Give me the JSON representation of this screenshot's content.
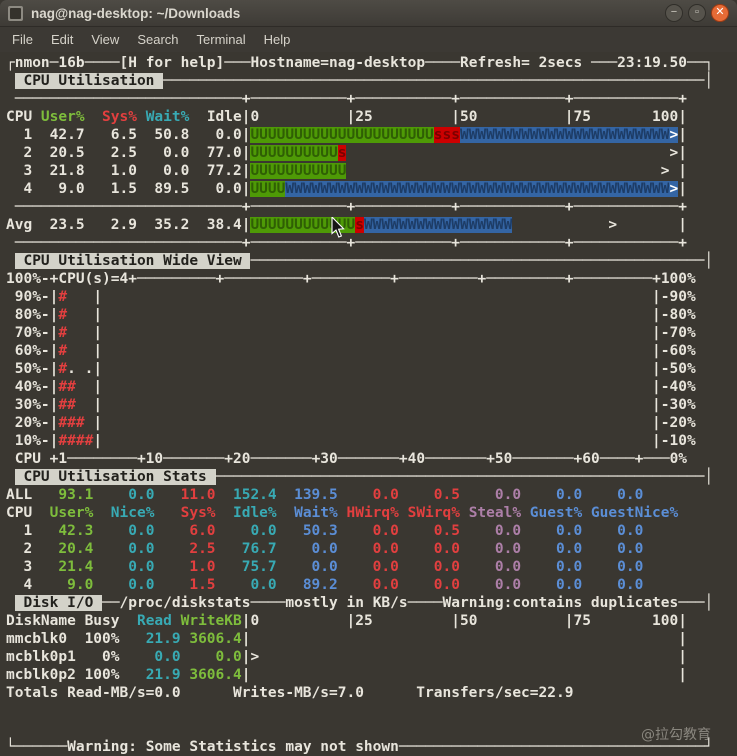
{
  "window": {
    "title": "nag@nag-desktop: ~/Downloads",
    "controls": [
      {
        "id": "minimize",
        "glyph": "−"
      },
      {
        "id": "maximize",
        "glyph": "▫"
      },
      {
        "id": "close",
        "glyph": "✕"
      }
    ]
  },
  "menu": {
    "items": [
      "File",
      "Edit",
      "View",
      "Search",
      "Terminal",
      "Help"
    ]
  },
  "watermark": "@拉勾教育",
  "colors": {
    "fg": "#e8e5dc",
    "bg": "#3a3731",
    "menubar": "#3c3934",
    "close": "#e66b36",
    "green": "#7ebd3c",
    "red": "#e23f3f",
    "cyan": "#38aab4",
    "blue": "#5b8ed6",
    "magenta": "#ad7fa8",
    "inverse_bg": "#d3d2c9",
    "inverse_fg": "#22211d",
    "bar_green": "#4e9a06",
    "bar_green_char": "#2f5f04",
    "bar_red": "#cc0000",
    "bar_red_char": "#7d0000",
    "bar_blue": "#3465a4",
    "bar_blue_char": "#1d3c66"
  },
  "terminal": {
    "lines": [
      [
        {
          "t": "┌nmon─16b"
        },
        {
          "ch": "─",
          "n": 4
        },
        {
          "t": "[H for help]"
        },
        {
          "ch": "─",
          "n": 3
        },
        {
          "t": "Hostname=nag-desktop"
        },
        {
          "ch": "─",
          "n": 4
        },
        {
          "t": "Refresh= 2secs "
        },
        {
          "ch": "─",
          "n": 3
        },
        {
          "t": "23:19.50"
        },
        {
          "ch": "─",
          "n": 2
        },
        {
          "t": "┐"
        }
      ],
      [
        {
          "t": " "
        },
        {
          "t": " CPU Utilisation ",
          "c": "i"
        },
        {
          "ch": "─",
          "n": 62
        },
        {
          "t": "│"
        }
      ],
      [
        {
          "t": " "
        },
        {
          "ch": "─",
          "n": 26
        },
        {
          "t": "+"
        },
        {
          "ch": "─",
          "n": 11
        },
        {
          "t": "+"
        },
        {
          "ch": "─",
          "n": 11
        },
        {
          "t": "+"
        },
        {
          "ch": "─",
          "n": 12
        },
        {
          "t": "+"
        },
        {
          "ch": "─",
          "n": 12
        },
        {
          "t": "+"
        }
      ],
      [
        {
          "t": "CPU "
        },
        {
          "t": "User%",
          "c": "g"
        },
        {
          "t": "  "
        },
        {
          "t": "Sys%",
          "c": "r"
        },
        {
          "t": " "
        },
        {
          "t": "Wait%",
          "c": "c"
        },
        {
          "t": "  "
        },
        {
          "t": "Idle"
        },
        {
          "t": "|0          |25         |50          |75       100|"
        }
      ],
      [
        {
          "t": "  1  42.7   6.5  50.8   0.0"
        },
        {
          "t": "|"
        },
        {
          "ch": "U",
          "n": 21,
          "c": "bu"
        },
        {
          "ch": "s",
          "n": 3,
          "c": "bs"
        },
        {
          "ch": "W",
          "n": 24,
          "c": "bw"
        },
        {
          "t": ">",
          "c": "bp"
        },
        {
          "t": "|"
        }
      ],
      [
        {
          "t": "  2  20.5   2.5   0.0  77.0"
        },
        {
          "t": "|"
        },
        {
          "ch": "U",
          "n": 10,
          "c": "bu"
        },
        {
          "ch": "s",
          "n": 1,
          "c": "bs"
        },
        {
          "ch": " ",
          "n": 37
        },
        {
          "t": ">"
        },
        {
          "t": "|"
        }
      ],
      [
        {
          "t": "  3  21.8   1.0   0.0  77.2"
        },
        {
          "t": "|"
        },
        {
          "ch": "U",
          "n": 11,
          "c": "bu"
        },
        {
          "ch": " ",
          "n": 36
        },
        {
          "t": ">"
        },
        {
          "t": " "
        },
        {
          "t": "|"
        }
      ],
      [
        {
          "t": "  4   9.0   1.5  89.5   0.0"
        },
        {
          "t": "|"
        },
        {
          "ch": "U",
          "n": 4,
          "c": "bu"
        },
        {
          "ch": "W",
          "n": 44,
          "c": "bw"
        },
        {
          "t": ">",
          "c": "bp"
        },
        {
          "t": "|"
        }
      ],
      [
        {
          "t": " "
        },
        {
          "ch": "─",
          "n": 26
        },
        {
          "t": "+"
        },
        {
          "ch": "─",
          "n": 11
        },
        {
          "t": "+"
        },
        {
          "ch": "─",
          "n": 11
        },
        {
          "t": "+"
        },
        {
          "ch": "─",
          "n": 12
        },
        {
          "t": "+"
        },
        {
          "ch": "─",
          "n": 12
        },
        {
          "t": "+"
        }
      ],
      [
        {
          "t": "Avg  23.5   2.9  35.2  38.4"
        },
        {
          "t": "|"
        },
        {
          "ch": "U",
          "n": 12,
          "c": "bu"
        },
        {
          "ch": "s",
          "n": 1,
          "c": "bs"
        },
        {
          "ch": "W",
          "n": 17,
          "c": "bw"
        },
        {
          "ch": " ",
          "n": 11
        },
        {
          "t": ">"
        },
        {
          "ch": " ",
          "n": 7
        },
        {
          "t": "|"
        }
      ],
      [
        {
          "t": " "
        },
        {
          "ch": "─",
          "n": 26
        },
        {
          "t": "+"
        },
        {
          "ch": "─",
          "n": 11
        },
        {
          "t": "+"
        },
        {
          "ch": "─",
          "n": 11
        },
        {
          "t": "+"
        },
        {
          "ch": "─",
          "n": 12
        },
        {
          "t": "+"
        },
        {
          "ch": "─",
          "n": 12
        },
        {
          "t": "+"
        }
      ],
      [
        {
          "t": " "
        },
        {
          "t": " CPU Utilisation Wide View ",
          "c": "i"
        },
        {
          "ch": "─",
          "n": 52
        },
        {
          "t": "│"
        }
      ],
      [
        {
          "t": "100%-+CPU(s)=4+"
        },
        {
          "ch": "─",
          "n": 9
        },
        {
          "t": "+"
        },
        {
          "ch": "─",
          "n": 9
        },
        {
          "t": "+"
        },
        {
          "ch": "─",
          "n": 9
        },
        {
          "t": "+"
        },
        {
          "ch": "─",
          "n": 9
        },
        {
          "t": "+"
        },
        {
          "ch": "─",
          "n": 9
        },
        {
          "t": "+"
        },
        {
          "ch": "─",
          "n": 9
        },
        {
          "t": "+"
        },
        {
          "t": "100%"
        }
      ],
      [
        {
          "t": " 90%-|"
        },
        {
          "t": "#",
          "c": "r"
        },
        {
          "t": "   "
        },
        {
          "t": "|"
        },
        {
          "ch": " ",
          "n": 63
        },
        {
          "t": "|-90%"
        }
      ],
      [
        {
          "t": " 80%-|"
        },
        {
          "t": "#",
          "c": "r"
        },
        {
          "t": "   "
        },
        {
          "t": "|"
        },
        {
          "ch": " ",
          "n": 63
        },
        {
          "t": "|-80%"
        }
      ],
      [
        {
          "t": " 70%-|"
        },
        {
          "t": "#",
          "c": "r"
        },
        {
          "t": "   "
        },
        {
          "t": "|"
        },
        {
          "ch": " ",
          "n": 63
        },
        {
          "t": "|-70%"
        }
      ],
      [
        {
          "t": " 60%-|"
        },
        {
          "t": "#",
          "c": "r"
        },
        {
          "t": "   "
        },
        {
          "t": "|"
        },
        {
          "ch": " ",
          "n": 63
        },
        {
          "t": "|-60%"
        }
      ],
      [
        {
          "t": " 50%-|"
        },
        {
          "t": "#",
          "c": "r"
        },
        {
          "t": ". ."
        },
        {
          "t": "|"
        },
        {
          "ch": " ",
          "n": 63
        },
        {
          "t": "|-50%"
        }
      ],
      [
        {
          "t": " 40%-|"
        },
        {
          "t": "##",
          "c": "r"
        },
        {
          "t": "  "
        },
        {
          "t": "|"
        },
        {
          "ch": " ",
          "n": 63
        },
        {
          "t": "|-40%"
        }
      ],
      [
        {
          "t": " 30%-|"
        },
        {
          "t": "##",
          "c": "r"
        },
        {
          "t": "  "
        },
        {
          "t": "|"
        },
        {
          "ch": " ",
          "n": 63
        },
        {
          "t": "|-30%"
        }
      ],
      [
        {
          "t": " 20%-|"
        },
        {
          "t": "###",
          "c": "r"
        },
        {
          "t": " "
        },
        {
          "t": "|"
        },
        {
          "ch": " ",
          "n": 63
        },
        {
          "t": "|-20%"
        }
      ],
      [
        {
          "t": " 10%-|"
        },
        {
          "t": "####",
          "c": "r"
        },
        {
          "t": "|"
        },
        {
          "ch": " ",
          "n": 63
        },
        {
          "t": "|-10%"
        }
      ],
      [
        {
          "t": " CPU +1"
        },
        {
          "ch": "─",
          "n": 8
        },
        {
          "t": "+10"
        },
        {
          "ch": "─",
          "n": 7
        },
        {
          "t": "+20"
        },
        {
          "ch": "─",
          "n": 7
        },
        {
          "t": "+30"
        },
        {
          "ch": "─",
          "n": 7
        },
        {
          "t": "+40"
        },
        {
          "ch": "─",
          "n": 7
        },
        {
          "t": "+50"
        },
        {
          "ch": "─",
          "n": 7
        },
        {
          "t": "+60"
        },
        {
          "ch": "─",
          "n": 4
        },
        {
          "t": "+"
        },
        {
          "ch": "─",
          "n": 3
        },
        {
          "t": "0%"
        }
      ],
      [
        {
          "t": " "
        },
        {
          "t": " CPU Utilisation Stats ",
          "c": "i"
        },
        {
          "ch": "─",
          "n": 56
        },
        {
          "t": "│"
        }
      ],
      [
        {
          "t": "ALL"
        },
        {
          "t": "   93.1",
          "c": "g"
        },
        {
          "t": "    0.0",
          "c": "c"
        },
        {
          "t": "   11.0",
          "c": "r"
        },
        {
          "t": "  152.4",
          "c": "c"
        },
        {
          "t": "  139.5",
          "c": "b"
        },
        {
          "t": "    0.0",
          "c": "r"
        },
        {
          "t": "    0.5",
          "c": "r"
        },
        {
          "t": "    0.0",
          "c": "m"
        },
        {
          "t": "    0.0",
          "c": "b"
        },
        {
          "t": "    0.0",
          "c": "b"
        }
      ],
      [
        {
          "t": "CPU"
        },
        {
          "t": "  User%",
          "c": "g"
        },
        {
          "t": "  Nice%",
          "c": "c"
        },
        {
          "t": "   Sys%",
          "c": "r"
        },
        {
          "t": "  Idle%",
          "c": "c"
        },
        {
          "t": "  Wait%",
          "c": "b"
        },
        {
          "t": " HWirq%",
          "c": "r"
        },
        {
          "t": " SWirq%",
          "c": "r"
        },
        {
          "t": " Steal%",
          "c": "m"
        },
        {
          "t": " Guest%",
          "c": "b"
        },
        {
          "t": " GuestNice%",
          "c": "b"
        }
      ],
      [
        {
          "t": "  1"
        },
        {
          "t": "   42.3",
          "c": "g"
        },
        {
          "t": "    0.0",
          "c": "c"
        },
        {
          "t": "    6.0",
          "c": "r"
        },
        {
          "t": "    0.0",
          "c": "c"
        },
        {
          "t": "   50.3",
          "c": "b"
        },
        {
          "t": "    0.0",
          "c": "r"
        },
        {
          "t": "    0.5",
          "c": "r"
        },
        {
          "t": "    0.0",
          "c": "m"
        },
        {
          "t": "    0.0",
          "c": "b"
        },
        {
          "t": "    0.0",
          "c": "b"
        }
      ],
      [
        {
          "t": "  2"
        },
        {
          "t": "   20.4",
          "c": "g"
        },
        {
          "t": "    0.0",
          "c": "c"
        },
        {
          "t": "    2.5",
          "c": "r"
        },
        {
          "t": "   76.7",
          "c": "c"
        },
        {
          "t": "    0.0",
          "c": "b"
        },
        {
          "t": "    0.0",
          "c": "r"
        },
        {
          "t": "    0.0",
          "c": "r"
        },
        {
          "t": "    0.0",
          "c": "m"
        },
        {
          "t": "    0.0",
          "c": "b"
        },
        {
          "t": "    0.0",
          "c": "b"
        }
      ],
      [
        {
          "t": "  3"
        },
        {
          "t": "   21.4",
          "c": "g"
        },
        {
          "t": "    0.0",
          "c": "c"
        },
        {
          "t": "    1.0",
          "c": "r"
        },
        {
          "t": "   75.7",
          "c": "c"
        },
        {
          "t": "    0.0",
          "c": "b"
        },
        {
          "t": "    0.0",
          "c": "r"
        },
        {
          "t": "    0.0",
          "c": "r"
        },
        {
          "t": "    0.0",
          "c": "m"
        },
        {
          "t": "    0.0",
          "c": "b"
        },
        {
          "t": "    0.0",
          "c": "b"
        }
      ],
      [
        {
          "t": "  4"
        },
        {
          "t": "    9.0",
          "c": "g"
        },
        {
          "t": "    0.0",
          "c": "c"
        },
        {
          "t": "    1.5",
          "c": "r"
        },
        {
          "t": "    0.0",
          "c": "c"
        },
        {
          "t": "   89.2",
          "c": "b"
        },
        {
          "t": "    0.0",
          "c": "r"
        },
        {
          "t": "    0.0",
          "c": "r"
        },
        {
          "t": "    0.0",
          "c": "m"
        },
        {
          "t": "    0.0",
          "c": "b"
        },
        {
          "t": "    0.0",
          "c": "b"
        }
      ],
      [
        {
          "t": " "
        },
        {
          "t": " Disk I/O ",
          "c": "i"
        },
        {
          "ch": "─",
          "n": 2
        },
        {
          "t": "/proc/diskstats"
        },
        {
          "ch": "─",
          "n": 4
        },
        {
          "t": "mostly in KB/s"
        },
        {
          "ch": "─",
          "n": 4
        },
        {
          "t": "Warning:contains duplicates"
        },
        {
          "ch": "─",
          "n": 3
        },
        {
          "t": "│"
        }
      ],
      [
        {
          "t": "DiskName Busy"
        },
        {
          "t": "  Read",
          "c": "c"
        },
        {
          "t": " WriteKB",
          "c": "g"
        },
        {
          "t": "|0          |25         |50          |75       100|"
        }
      ],
      [
        {
          "t": "mmcblk0  100%"
        },
        {
          "t": "   21.9",
          "c": "c"
        },
        {
          "t": " 3606.4",
          "c": "g"
        },
        {
          "t": "|"
        },
        {
          "ch": " ",
          "n": 49
        },
        {
          "t": "|"
        }
      ],
      [
        {
          "t": "mcblk0p1   0%"
        },
        {
          "t": "    0.0",
          "c": "c"
        },
        {
          "t": "    0.0",
          "c": "g"
        },
        {
          "t": "|"
        },
        {
          "t": ">"
        },
        {
          "ch": " ",
          "n": 48
        },
        {
          "t": "|"
        }
      ],
      [
        {
          "t": "mcblk0p2 100%"
        },
        {
          "t": "   21.9",
          "c": "c"
        },
        {
          "t": " 3606.4",
          "c": "g"
        },
        {
          "t": "|"
        },
        {
          "ch": " ",
          "n": 49
        },
        {
          "t": "|"
        }
      ],
      [
        {
          "t": "Totals Read-MB/s=0.0      Writes-MB/s=7.0      Transfers/sec=22.9"
        }
      ],
      [],
      [],
      [
        {
          "t": "└"
        },
        {
          "ch": "─",
          "n": 6
        },
        {
          "t": "Warning: Some Statistics may not shown"
        },
        {
          "ch": "─",
          "n": 35
        },
        {
          "t": "┘"
        }
      ]
    ]
  }
}
